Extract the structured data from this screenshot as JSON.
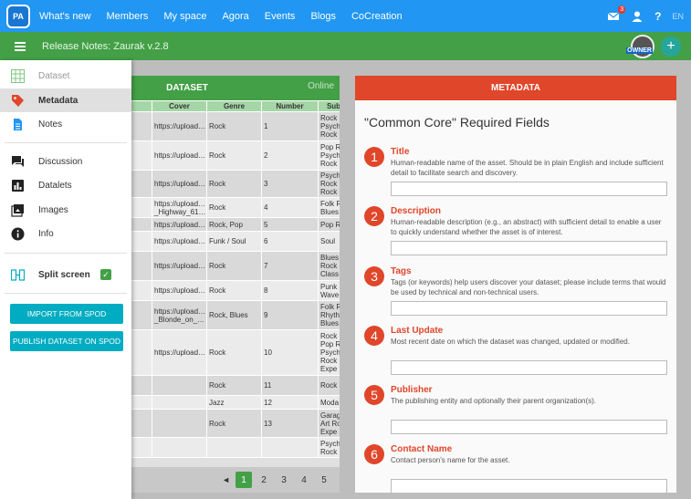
{
  "nav": {
    "logo_text": "PA",
    "links": [
      "What's new",
      "Members",
      "My space",
      "Agora",
      "Events",
      "Blogs",
      "CoCreation"
    ],
    "mail_badge": "3",
    "help": "?",
    "lang": "EN"
  },
  "toolbar": {
    "title": "Release Notes: Zaurak v.2.8",
    "owner_label": "OWNER",
    "add_label": "+"
  },
  "drawer": {
    "items": [
      {
        "label": "Dataset",
        "icon": "grid-icon"
      },
      {
        "label": "Metadata",
        "icon": "tag-icon"
      },
      {
        "label": "Notes",
        "icon": "document-icon"
      },
      {
        "label": "Discussion",
        "icon": "chat-icon"
      },
      {
        "label": "Datalets",
        "icon": "bar-chart-icon"
      },
      {
        "label": "Images",
        "icon": "image-icon"
      },
      {
        "label": "Info",
        "icon": "info-icon"
      }
    ],
    "split_label": "Split screen",
    "split_checked": true,
    "import_label": "IMPORT FROM SPOD",
    "publish_label": "PUBLISH DATASET ON SPOD"
  },
  "dataset": {
    "title": "DATASET",
    "status": "Online",
    "columns": [
      "t",
      "Cover",
      "Genre",
      "Number",
      "Sub"
    ],
    "rows": [
      {
        "c0": "es",
        "cover": "https://upload…",
        "genre": "Rock",
        "num": "1",
        "sub": "Rock\nPsych\nRock"
      },
      {
        "c0": "n",
        "cover": "https://upload…",
        "genre": "Rock",
        "num": "2",
        "sub": "Pop R\nPsych\nRock"
      },
      {
        "c0": "es",
        "cover": "https://upload…",
        "genre": "Rock",
        "num": "3",
        "sub": "Psych\nRock\nRock"
      },
      {
        "c0": "",
        "cover": "https://upload…\n_Highway_61…",
        "genre": "Rock",
        "num": "4",
        "sub": "Folk R\nBlues"
      },
      {
        "c0": "es",
        "cover": "https://upload…",
        "genre": "Rock, Pop",
        "num": "5",
        "sub": "Pop R"
      },
      {
        "c0": "ye",
        "cover": "https://upload…",
        "genre": "Funk / Soul",
        "num": "6",
        "sub": "Soul"
      },
      {
        "c0": "g",
        "cover": "https://upload…",
        "genre": "Rock",
        "num": "7",
        "sub": "Blues\nRock\nClass"
      },
      {
        "c0": "",
        "cover": "https://upload…",
        "genre": "Rock",
        "num": "8",
        "sub": "Punk\nWave"
      },
      {
        "c0": "",
        "cover": "https://upload…\n_Blonde_on_…",
        "genre": "Rock, Blues",
        "num": "9",
        "sub": "Folk R\nRhyth\nBlues"
      },
      {
        "c0": "es",
        "cover": "https://upload…",
        "genre": "Rock",
        "num": "10",
        "sub": "Rock\nPop R\nPsych\nRock\nExpe"
      },
      {
        "c0": "ey",
        "cover": "",
        "genre": "Rock",
        "num": "11",
        "sub": "Rock"
      },
      {
        "c0": "s",
        "cover": "",
        "genre": "Jazz",
        "num": "12",
        "sub": "Moda"
      },
      {
        "c0": "nd",
        "cover": "",
        "genre": "Rock",
        "num": "13",
        "sub": "Garag\nArt Ro\nExpe"
      },
      {
        "c0": "",
        "cover": "",
        "genre": "",
        "num": "",
        "sub": "Psych\nRock"
      }
    ],
    "pages": [
      "1",
      "2",
      "3",
      "4",
      "5"
    ],
    "prev": "◄"
  },
  "metadata": {
    "header": "METADATA",
    "section_title": "\"Common Core\" Required Fields",
    "fields": [
      {
        "n": "1",
        "name": "Title",
        "desc": "Human-readable name of the asset. Should be in plain English and include sufficient detail to facilitate search and discovery.",
        "value": ""
      },
      {
        "n": "2",
        "name": "Description",
        "desc": "Human-readable description (e.g., an abstract) with sufficient detail to enable a user to quickly understand whether the asset is of interest.",
        "value": ""
      },
      {
        "n": "3",
        "name": "Tags",
        "desc": "Tags (or keywords) help users discover your dataset; please include terms that would be used by technical and non-technical users.",
        "value": ""
      },
      {
        "n": "4",
        "name": "Last Update",
        "desc": "Most recent date on which the dataset was changed, updated or modified.",
        "value": ""
      },
      {
        "n": "5",
        "name": "Publisher",
        "desc": "The publishing entity and optionally their parent organization(s).",
        "value": ""
      },
      {
        "n": "6",
        "name": "Contact Name",
        "desc": "Contact person's name for the asset.",
        "value": ""
      }
    ]
  },
  "colors": {
    "nav_blue": "#2196f3",
    "green": "#43a047",
    "metadata_red": "#e0462a",
    "button_teal": "#00acc1"
  }
}
